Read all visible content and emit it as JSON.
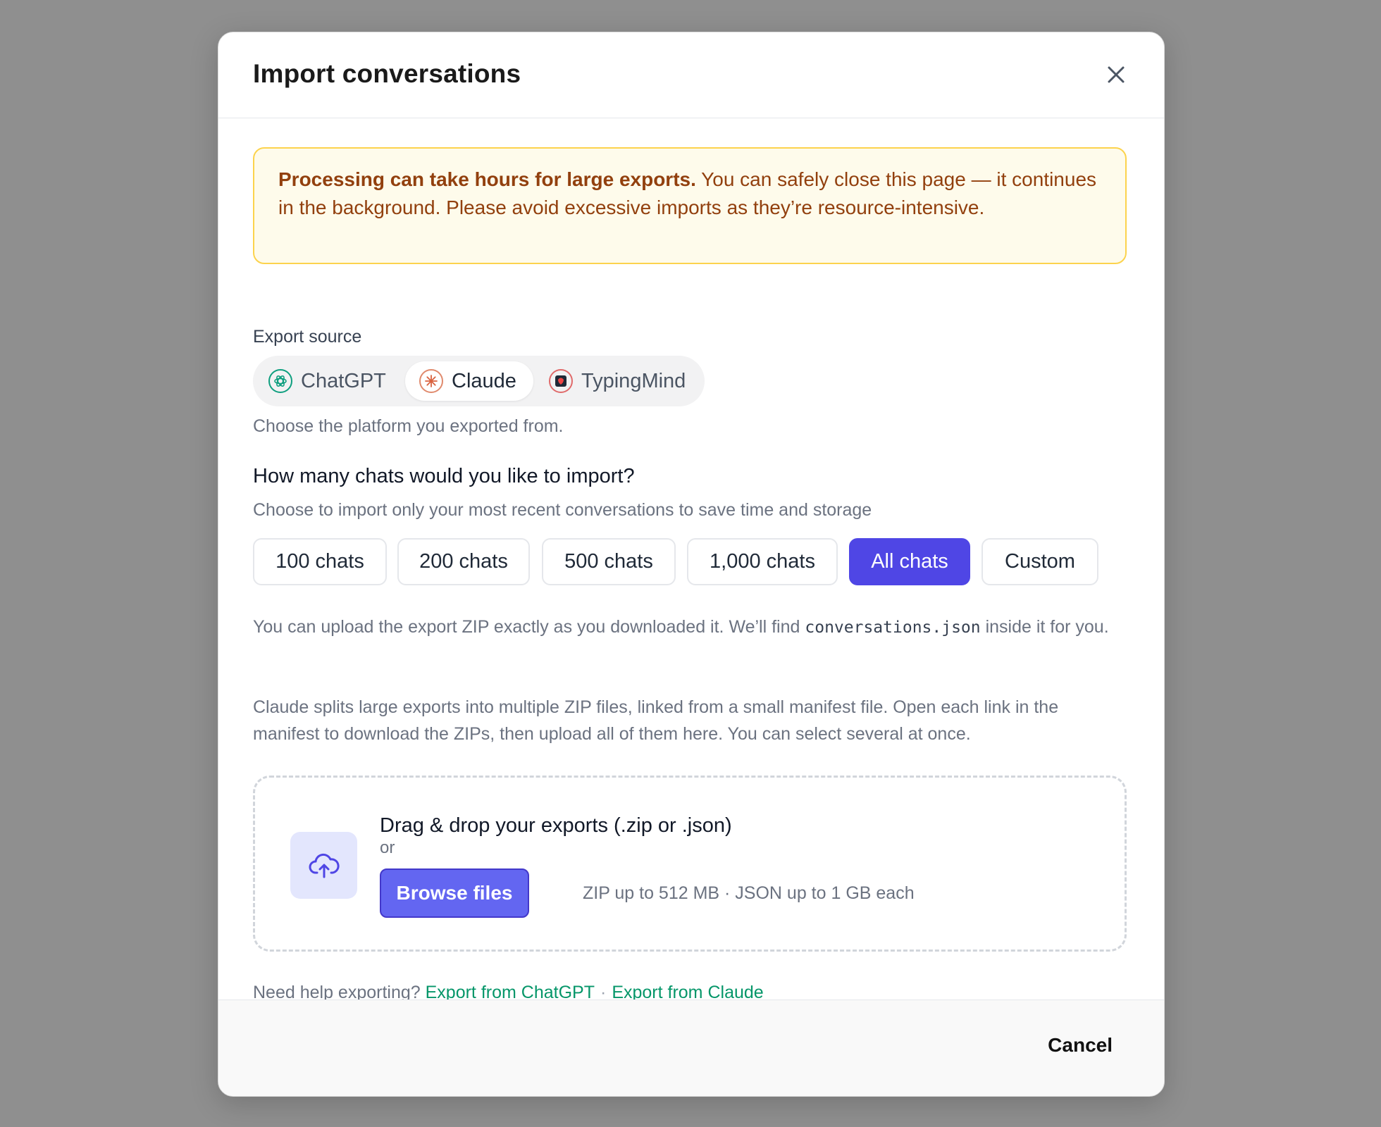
{
  "modal": {
    "title": "Import conversations"
  },
  "warning": {
    "bold": "Processing can take hours for large exports.",
    "text": " You can safely close this page — it continues in the background. Please avoid excessive imports as they’re resource-intensive."
  },
  "source": {
    "label": "Export source",
    "options": [
      {
        "label": "ChatGPT",
        "icon": "chatgpt-icon"
      },
      {
        "label": "Claude",
        "icon": "claude-icon",
        "selected": true
      },
      {
        "label": "TypingMind",
        "icon": "typingmind-icon"
      }
    ],
    "hint": "Choose the platform you exported from."
  },
  "count": {
    "question": "How many chats would you like to import?",
    "subtitle": "Choose to import only your most recent conversations to save time and storage",
    "options": [
      "100 chats",
      "200 chats",
      "500 chats",
      "1,000 chats",
      "All chats",
      "Custom"
    ],
    "selected": "All chats"
  },
  "notes": {
    "zip_before": "You can upload the export ZIP exactly as you downloaded it. We’ll find ",
    "zip_code": "conversations.json",
    "zip_after": " inside it for you.",
    "claude_split": "Claude splits large exports into multiple ZIP files, linked from a small manifest file. Open each link in the manifest to download the ZIPs, then upload all of them here. You can select several at once."
  },
  "dropzone": {
    "title": "Drag & drop your exports (.zip or .json)",
    "or": "or",
    "browse_label": "Browse files",
    "limits": "ZIP up to 512 MB · JSON up to 1 GB each",
    "icon": "cloud-upload-icon"
  },
  "help": {
    "prefix": "Need help exporting?",
    "link_chatgpt": "Export from ChatGPT",
    "separator": "·",
    "link_claude": "Export from Claude"
  },
  "footer": {
    "cancel_label": "Cancel"
  },
  "colors": {
    "accent": "#4f46e5",
    "browse": "#6366f1",
    "warning_bg": "#fefbeb",
    "warning_border": "#fcd34d",
    "warning_text": "#92400e",
    "link": "#059669"
  }
}
